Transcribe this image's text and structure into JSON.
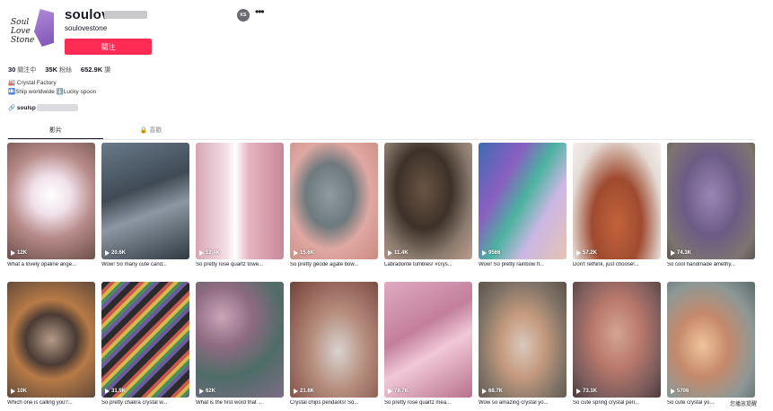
{
  "profile": {
    "avatar_text": "Soul Love Stone",
    "username": "soulove",
    "subname": "soulovestone",
    "follow_label": "關注",
    "verified_icon": "profile-badge-icon",
    "more_icon": "more-icon",
    "stats": {
      "following_count": "30",
      "following_label": "關注中",
      "followers_count": "35K",
      "followers_label": "粉絲",
      "likes_count": "652.9K",
      "likes_label": "讚"
    },
    "bio_line1": "🏭 Crystal Factory",
    "bio_line2": "🛄Ship worldwide ⬇️Lucky spoon",
    "link": "soulsp"
  },
  "tabs": {
    "videos": "影片",
    "liked": "🔒 喜歡"
  },
  "videos": [
    {
      "views": "12K",
      "caption": "What a lovely opaline ange..."
    },
    {
      "views": "20.6K",
      "caption": "Wow! So many cute cand..."
    },
    {
      "views": "12.4K",
      "caption": "So pretty rose quartz towe..."
    },
    {
      "views": "15.6K",
      "caption": "So pretty geode agate bow..."
    },
    {
      "views": "11.4K",
      "caption": "Labradorite tumbles! #crys..."
    },
    {
      "views": "9566",
      "caption": "Wow! So pretty rainbow fl..."
    },
    {
      "views": "57.2K",
      "caption": "Don't rethink, just choose!..."
    },
    {
      "views": "74.3K",
      "caption": "So cool handmade amethy..."
    },
    {
      "views": "10K",
      "caption": "Which one is calling you?..."
    },
    {
      "views": "31.5K",
      "caption": "So pretty chakra crystal w..."
    },
    {
      "views": "62K",
      "caption": "What is the first word that ..."
    },
    {
      "views": "21.6K",
      "caption": "Crystal chips pendants! So..."
    },
    {
      "views": "79.7K",
      "caption": "So pretty rose quartz mea..."
    },
    {
      "views": "68.7K",
      "caption": "Wow so amazing crystal yo..."
    },
    {
      "views": "73.1K",
      "caption": "So cute spring crystal peri..."
    },
    {
      "views": "5706",
      "caption": "So cute crystal yo..."
    }
  ],
  "watermark": "您播放提醒"
}
